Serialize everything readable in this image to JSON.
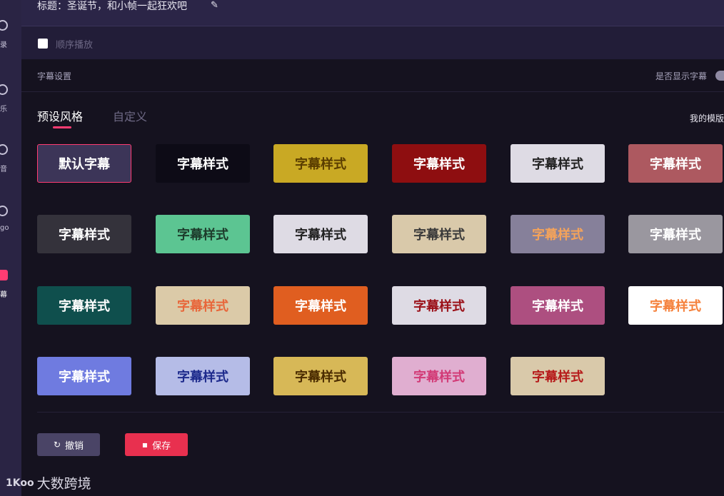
{
  "header": {
    "title": "标题：圣诞节，和小帧一起狂欢吧",
    "edit_icon": "✎"
  },
  "order": {
    "label": "顺序播放",
    "checked": false
  },
  "subtitle_settings": {
    "section_label": "字幕设置",
    "show_subtitles_label": "是否显示字幕"
  },
  "tabs": [
    {
      "label": "预设风格",
      "active": true
    },
    {
      "label": "自定义",
      "active": false
    }
  ],
  "my_templates_label": "我的模版",
  "styles": [
    {
      "label": "默认字幕",
      "bg": "#3c3558",
      "color": "#ffffff",
      "selected": true
    },
    {
      "label": "字幕样式",
      "bg": "#0d0b16",
      "color": "#ffffff"
    },
    {
      "label": "字幕样式",
      "bg": "#c9a924",
      "color": "#5a3d00"
    },
    {
      "label": "字幕样式",
      "bg": "#8e0e10",
      "color": "#ffffff"
    },
    {
      "label": "字幕样式",
      "bg": "#dedbe4",
      "color": "#222222"
    },
    {
      "label": "字幕样式",
      "bg": "#ad5960",
      "color": "#ffffff"
    },
    {
      "label": "字幕样式",
      "bg": "#34323b",
      "color": "#ffffff"
    },
    {
      "label": "字幕样式",
      "bg": "#5cc592",
      "color": "#1d3b2b"
    },
    {
      "label": "字幕样式",
      "bg": "#dedbe4",
      "color": "#222222"
    },
    {
      "label": "字幕样式",
      "bg": "#d9c9aa",
      "color": "#3a3a3a"
    },
    {
      "label": "字幕样式",
      "bg": "#86809a",
      "color": "#f5a35a"
    },
    {
      "label": "字幕样式",
      "bg": "#9a979f",
      "color": "#ffffff"
    },
    {
      "label": "字幕样式",
      "bg": "#0f4f4d",
      "color": "#ffffff"
    },
    {
      "label": "字幕样式",
      "bg": "#dbcaa8",
      "color": "#e8663a"
    },
    {
      "label": "字幕样式",
      "bg": "#e05e20",
      "color": "#ffffff"
    },
    {
      "label": "字幕样式",
      "bg": "#dedbe4",
      "color": "#9b1018"
    },
    {
      "label": "字幕样式",
      "bg": "#ad4f80",
      "color": "#ffffff"
    },
    {
      "label": "字幕样式",
      "bg": "#ffffff",
      "color": "#f5813c"
    },
    {
      "label": "字幕样式",
      "bg": "#6f7be0",
      "color": "#ffffff"
    },
    {
      "label": "字幕样式",
      "bg": "#b5bce7",
      "color": "#1d2a8c"
    },
    {
      "label": "字幕样式",
      "bg": "#d7b857",
      "color": "#4a2b00"
    },
    {
      "label": "字幕样式",
      "bg": "#e0aed0",
      "color": "#d23a76"
    },
    {
      "label": "字幕样式",
      "bg": "#d9c9aa",
      "color": "#b61a1a"
    }
  ],
  "buttons": {
    "undo_label": "撤销",
    "undo_icon": "↻",
    "save_label": "保存",
    "save_icon": "▪"
  },
  "watermark": {
    "logo": "1Koo",
    "text": "大数跨境"
  },
  "sidebar": [
    {
      "label": "录"
    },
    {
      "label": "乐"
    },
    {
      "label": "音"
    },
    {
      "label": "go"
    },
    {
      "label": "幕",
      "active": true
    }
  ]
}
